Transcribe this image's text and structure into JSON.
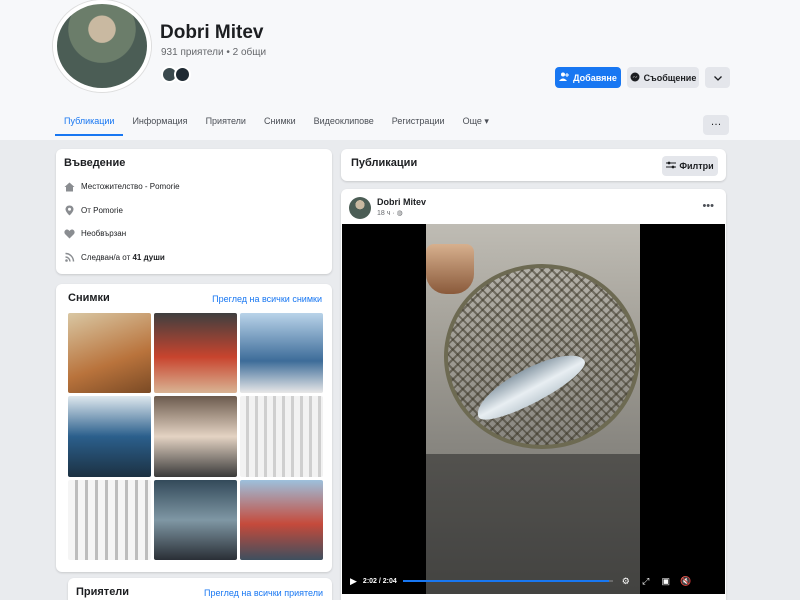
{
  "profile": {
    "name": "Dobri Mitev",
    "friends_summary": "931 приятели • 2 общи",
    "add_button": "Добавяне",
    "message_button": "Съобщение",
    "more_button_icon": "chevron-down-icon"
  },
  "tabs": [
    {
      "label": "Публикации",
      "active": true
    },
    {
      "label": "Информация",
      "active": false
    },
    {
      "label": "Приятели",
      "active": false
    },
    {
      "label": "Снимки",
      "active": false
    },
    {
      "label": "Видеоклипове",
      "active": false
    },
    {
      "label": "Регистрации",
      "active": false
    },
    {
      "label": "Още",
      "active": false
    }
  ],
  "intro": {
    "title": "Въведение",
    "residence_label": "Местожителство - ",
    "residence_value": "Pomorie",
    "from_label": "От ",
    "from_value": "Pomorie",
    "relationship": "Необвързан",
    "followers_label": "Следван/а от ",
    "followers_value": "41 души"
  },
  "photos": {
    "title": "Снимки",
    "see_all": "Преглед на всички снимки"
  },
  "friends": {
    "title": "Приятели",
    "see_all": "Преглед на всички приятели"
  },
  "posts": {
    "title": "Публикации",
    "filters": "Филтри",
    "author": "Dobri Mitev",
    "time": "18 ч ·",
    "video_time": "2:02 / 2:04",
    "video_progress": 0.98
  },
  "colors": {
    "accent": "#1877f2",
    "background": "#e9ebee"
  }
}
